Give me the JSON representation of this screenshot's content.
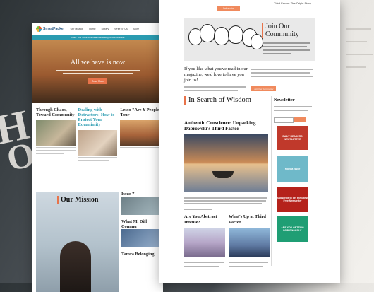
{
  "left_page": {
    "logo_text": "SmartPacker",
    "nav": [
      "Our Mission",
      "Home",
      "Library",
      "Write for Us",
      "Store"
    ],
    "teal_banner": "Read: Your Move to Abraham Wellbeing Is Now Available",
    "hero_title": "All we have is now",
    "hero_button": "Read More",
    "columns": [
      {
        "title": "Through Chaos, Toward Community",
        "teal": false
      },
      {
        "title": "Dealing with Detractors: How to Protect Your Equanimity",
        "teal": true
      },
      {
        "title": "Lesso \"Are Y People Tour",
        "teal": false
      }
    ],
    "mission_title": "Our Mission",
    "side_items": [
      "Issue 7",
      "What Mi Diff Commu",
      "Tamra Belonging"
    ]
  },
  "right_page": {
    "top_button": "Subscribe",
    "origin_story": "Third Factor: The Origin Story",
    "join_title": "Join Our Community",
    "like_text": "If you like what you've read in our magazine, we'd love to have you join us!",
    "subscribe_button": "Join Our Community",
    "search_title": "In Search of Wisdom",
    "article_title": "Authentic Conscience: Unpacking Dabrowski's Third Factor",
    "abstract_title": "Are You Abstract Intense?",
    "third_title": "What's Up at Third Factor",
    "newsletter_title": "Newsletter",
    "ads": [
      {
        "line1": "DAILY READERS",
        "line2": "NEWSLETTER",
        "color": "#c0392b"
      },
      {
        "line1": "Florida Issue",
        "line2": "",
        "color": "#6fb9c9"
      },
      {
        "line1": "Subscribe to get the latest",
        "line2": "Free Newsletter",
        "color": "#b5221b"
      },
      {
        "line1": "ARE YOU GETTING",
        "line2": "PAID ENOUGH?",
        "color": "#1f9e74"
      }
    ]
  }
}
